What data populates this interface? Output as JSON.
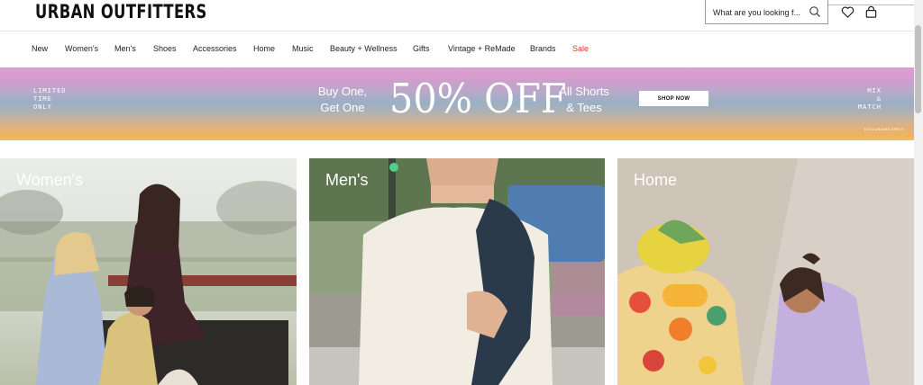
{
  "header": {
    "logo": "URBAN OUTFITTERS",
    "search_placeholder": "What are you looking f...",
    "icons": [
      "search-icon",
      "heart-icon",
      "bag-icon"
    ]
  },
  "nav": {
    "items": [
      {
        "label": "New"
      },
      {
        "label": "Women's"
      },
      {
        "label": "Men's"
      },
      {
        "label": "Shoes"
      },
      {
        "label": "Accessories"
      },
      {
        "label": "Home"
      },
      {
        "label": "Music"
      },
      {
        "label": "Beauty + Wellness"
      },
      {
        "label": "Gifts"
      },
      {
        "label": "Vintage + ReMade"
      },
      {
        "label": "Brands"
      },
      {
        "label": "Sale",
        "color": "#d2412a"
      }
    ]
  },
  "banner": {
    "left_text": "LIMITED\nTIME\nONLY",
    "offer_left": "Buy One,\nGet One",
    "offer_big": "50% OFF",
    "offer_right": "All Shorts\n& Tees",
    "button_label": "SHOP NOW",
    "right_text": "MIX\n&\nMATCH",
    "exclusions": "EXCLUSIONS APPLY"
  },
  "tiles": [
    {
      "label": "Women's"
    },
    {
      "label": "Men's"
    },
    {
      "label": "Home"
    }
  ],
  "colors": {
    "sale": "#d2412a",
    "text": "#111111"
  }
}
